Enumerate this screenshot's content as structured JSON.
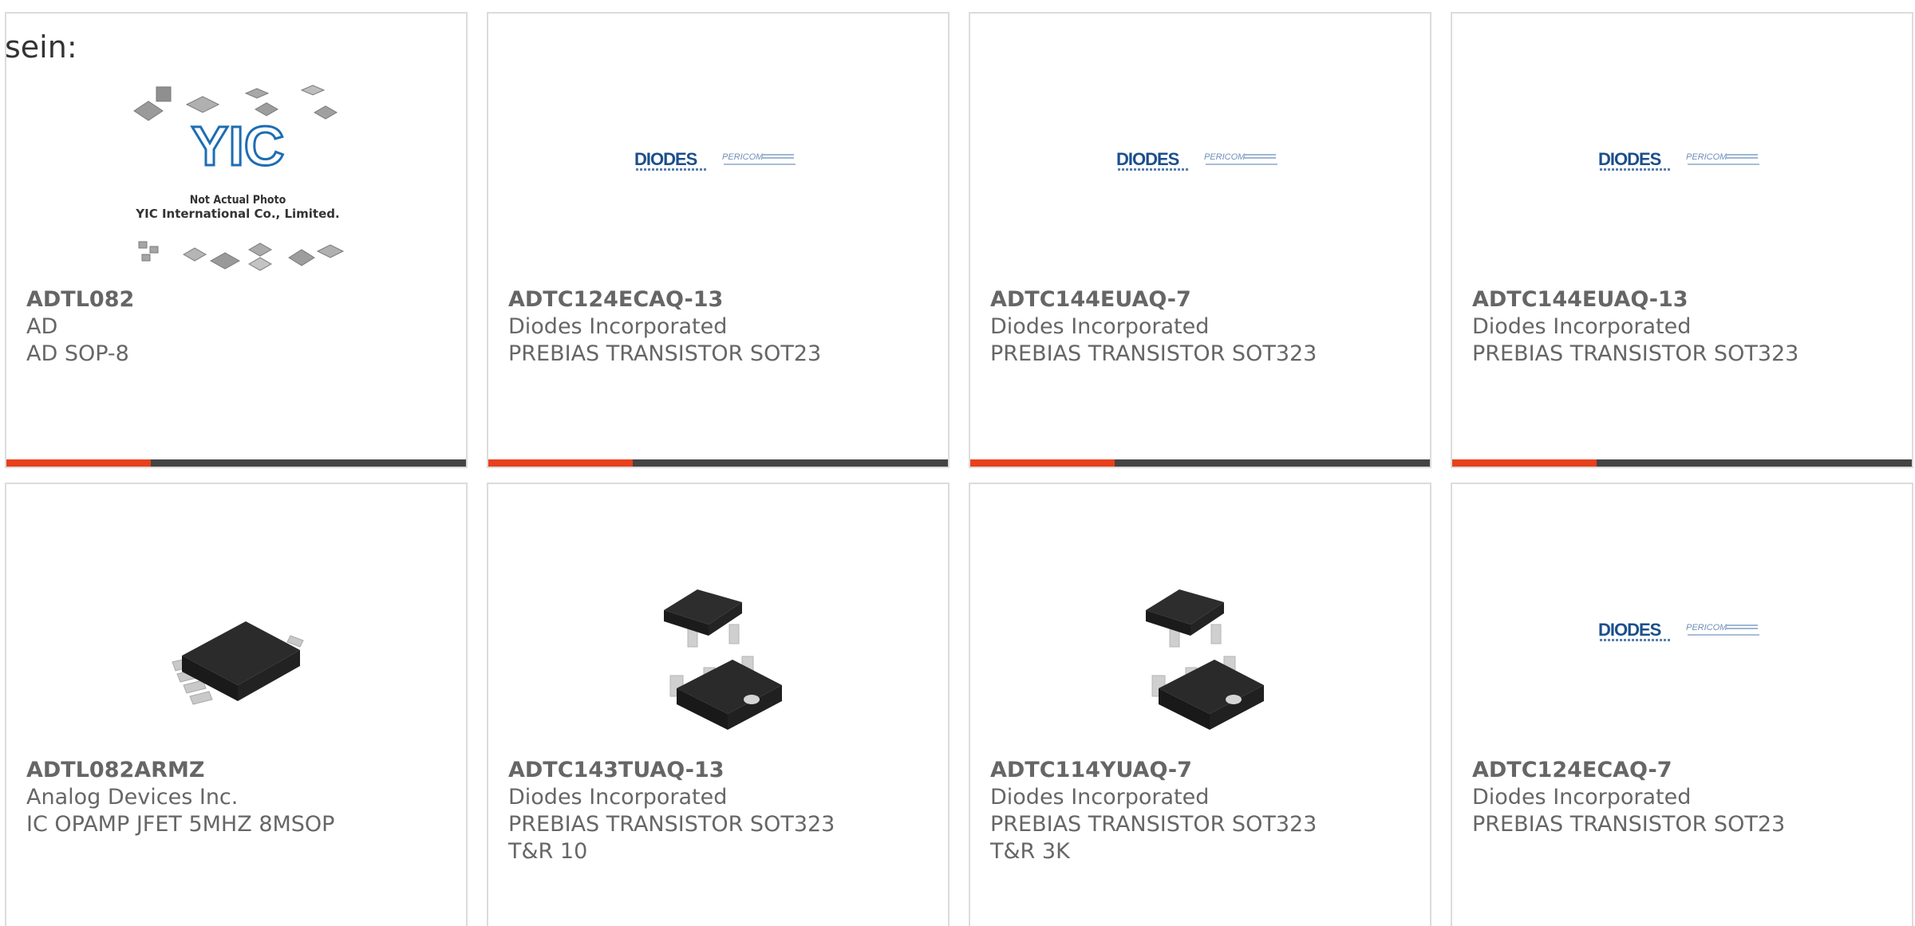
{
  "lead_text": "sein:",
  "colors": {
    "accent_bar": "#e8401c",
    "dark_bar": "#444444",
    "card_border": "#dcdcdc",
    "text": "#666666",
    "diodes_blue": "#1c4f8c"
  },
  "products": [
    {
      "part": "ADTL082",
      "manufacturer": "AD",
      "description": "AD SOP-8",
      "image": "yic-not-actual-photo",
      "image_text_1": "Not Actual Photo",
      "image_text_2": "YIC International Co., Limited.",
      "image_logo": "YIC"
    },
    {
      "part": "ADTC124ECAQ-13",
      "manufacturer": "Diodes Incorporated",
      "description": "PREBIAS TRANSISTOR SOT23",
      "image": "diodes-logo",
      "logo_main": "DIODES",
      "logo_secondary": "PERICOM"
    },
    {
      "part": "ADTC144EUAQ-7",
      "manufacturer": "Diodes Incorporated",
      "description": "PREBIAS TRANSISTOR SOT323",
      "image": "diodes-logo",
      "logo_main": "DIODES",
      "logo_secondary": "PERICOM"
    },
    {
      "part": "ADTC144EUAQ-13",
      "manufacturer": "Diodes Incorporated",
      "description": "PREBIAS TRANSISTOR SOT323",
      "image": "diodes-logo",
      "logo_main": "DIODES",
      "logo_secondary": "PERICOM"
    },
    {
      "part": "ADTL082ARMZ",
      "manufacturer": "Analog Devices Inc.",
      "description": "IC OPAMP JFET 5MHZ 8MSOP",
      "image": "msop-chip-photo"
    },
    {
      "part": "ADTC143TUAQ-13",
      "manufacturer": "Diodes Incorporated",
      "description": "PREBIAS TRANSISTOR SOT323",
      "description_2": "T&R 10",
      "image": "sot323-transistor-photo"
    },
    {
      "part": "ADTC114YUAQ-7",
      "manufacturer": "Diodes Incorporated",
      "description": "PREBIAS TRANSISTOR SOT323",
      "description_2": "T&R 3K",
      "image": "sot323-transistor-photo"
    },
    {
      "part": "ADTC124ECAQ-7",
      "manufacturer": "Diodes Incorporated",
      "description": "PREBIAS TRANSISTOR SOT23",
      "image": "diodes-logo",
      "logo_main": "DIODES",
      "logo_secondary": "PERICOM"
    }
  ]
}
